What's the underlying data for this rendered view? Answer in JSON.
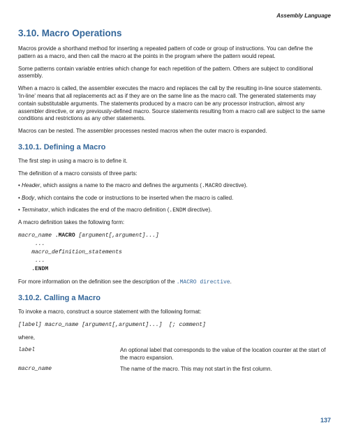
{
  "header": {
    "running": "Assembly Language"
  },
  "section": {
    "h1": "3.10. Macro Operations",
    "p1": "Macros provide a shorthand method for inserting a repeated pattern of code or group of instructions. You can define the pattern as a macro, and then call the macro at the points in the program where the pattern would repeat.",
    "p2": "Some patterns contain variable entries which change for each repetition of the pattern. Others are subject to conditional assembly.",
    "p3": "When a macro is called, the assembler executes the macro and replaces the call by the resulting in-line source statements. 'In-line' means that all replacements act as if they are on the same line as the macro call. The generated statements may contain substitutable arguments. The statements produced by a macro can be any processor instruction, almost any assembler directive, or any previously-defined macro. Source statements resulting from a macro call are subject to the same conditions and restrictions as any other statements.",
    "p4": "Macros can be nested. The assembler processes nested macros when the outer macro is expanded."
  },
  "sub1": {
    "h2": "3.10.1. Defining a Macro",
    "p1": "The first step in using a macro is to define it.",
    "p2": "The definition of a macro consists of three parts:",
    "b1_kw": "Header",
    "b1_rest": ", which assigns a name to the macro and defines the arguments (",
    "b1_code": ".MACRO",
    "b1_tail": " directive).",
    "b2_kw": "Body",
    "b2_rest": ", which contains the code or instructions to be inserted when the macro is called.",
    "b3_kw": "Terminator",
    "b3_rest": ", which indicates the end of the macro definition (",
    "b3_code": ".ENDM",
    "b3_tail": " directive).",
    "p3": "A macro definition takes the following form:",
    "code": "macro_name .MACRO [argument[,argument]...]\n     ...\n    macro_definition_statements\n     ...\n    .ENDM",
    "p4_a": "For more information on the definition see the description of the ",
    "p4_link": ".MACRO directive",
    "p4_b": "."
  },
  "sub2": {
    "h2": "3.10.2. Calling a Macro",
    "p1": "To invoke a macro, construct a source statement with the following format:",
    "code": "[label] macro_name [argument[,argument]...]  [; comment]",
    "p2": "where,",
    "t1": "label",
    "d1": "An optional label that corresponds to the value of the location counter at the start of the macro expansion.",
    "t2": "macro_name",
    "d2": "The name of the macro. This may not start in the first column."
  },
  "page": {
    "num": "137"
  }
}
